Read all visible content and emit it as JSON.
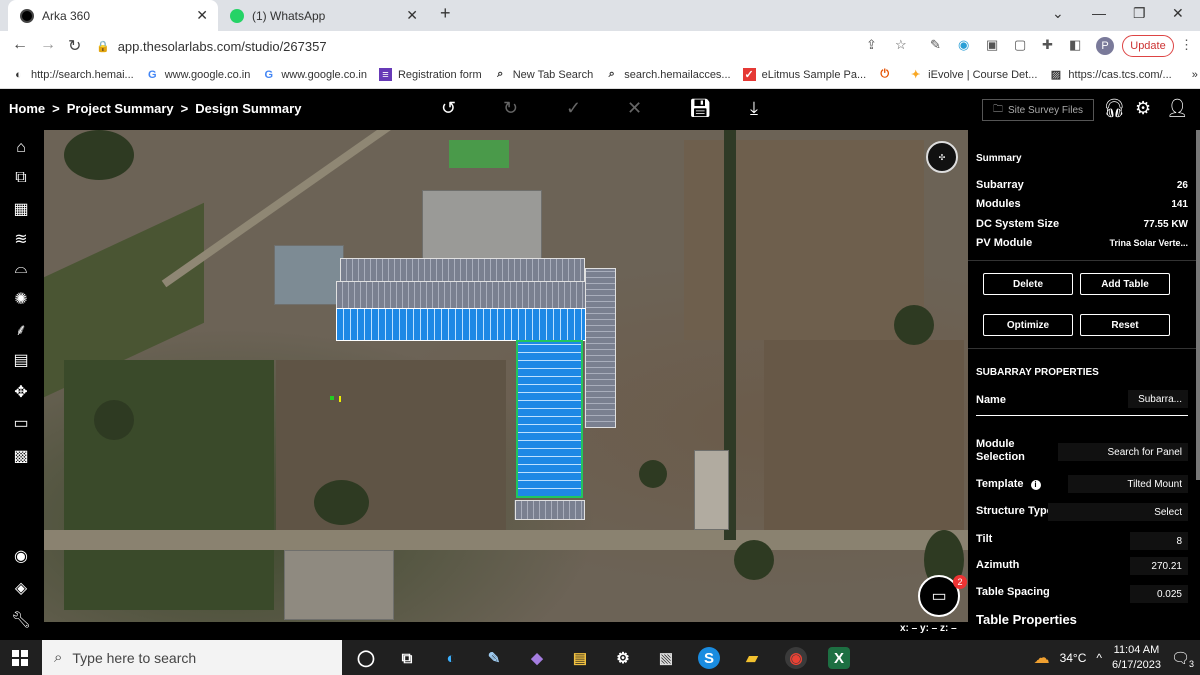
{
  "browser": {
    "tabs": [
      {
        "label": "Arka 360",
        "active": true
      },
      {
        "label": "(1) WhatsApp",
        "active": false
      }
    ],
    "url": "app.thesolarlabs.com/studio/267357",
    "profile_initial": "P",
    "update_label": "Update",
    "bookmarks": [
      "http://search.hemai...",
      "www.google.co.in",
      "www.google.co.in",
      "Registration form",
      "New Tab Search",
      "search.hemailacces...",
      "eLitmus Sample Pa...",
      "iEvolve | Course Det...",
      "https://cas.tcs.com/..."
    ]
  },
  "header": {
    "breadcrumb": [
      "Home",
      ">",
      "Project Summary",
      ">",
      "Design Summary"
    ],
    "site_survey_label": "Site Survey Files"
  },
  "summary": {
    "title": "Summary",
    "rows": [
      {
        "label": "Subarray",
        "value": "26"
      },
      {
        "label": "Modules",
        "value": "141"
      },
      {
        "label": "DC System Size",
        "value": "77.55 KW"
      },
      {
        "label": "PV Module",
        "value": "Trina Solar Verte..."
      }
    ],
    "buttons": {
      "delete": "Delete",
      "add_table": "Add Table",
      "optimize": "Optimize",
      "reset": "Reset"
    }
  },
  "subarray": {
    "title": "SUBARRAY PROPERTIES",
    "name_label": "Name",
    "name_value": "Subarra...",
    "module_selection_label": "Module Selection",
    "module_selection_value": "Search for Panel",
    "template_label": "Template",
    "template_value": "Tilted Mount",
    "structure_type_label": "Structure Type",
    "structure_type_value": "Select",
    "tilt_label": "Tilt",
    "tilt_value": "8",
    "azimuth_label": "Azimuth",
    "azimuth_value": "270.21",
    "table_spacing_label": "Table Spacing",
    "table_spacing_value": "0.025",
    "table_properties_label": "Table Properties"
  },
  "map": {
    "coords": "x: – y: – z: –",
    "chat_badge": "2"
  },
  "taskbar": {
    "search_placeholder": "Type here to search",
    "temperature": "34°C",
    "time": "11:04 AM",
    "date": "6/17/2023",
    "notification_count": "3"
  },
  "colors": {
    "panel_blue": "#1e90ff",
    "selection_green": "#22c55e",
    "update_red": "#cc3333"
  }
}
